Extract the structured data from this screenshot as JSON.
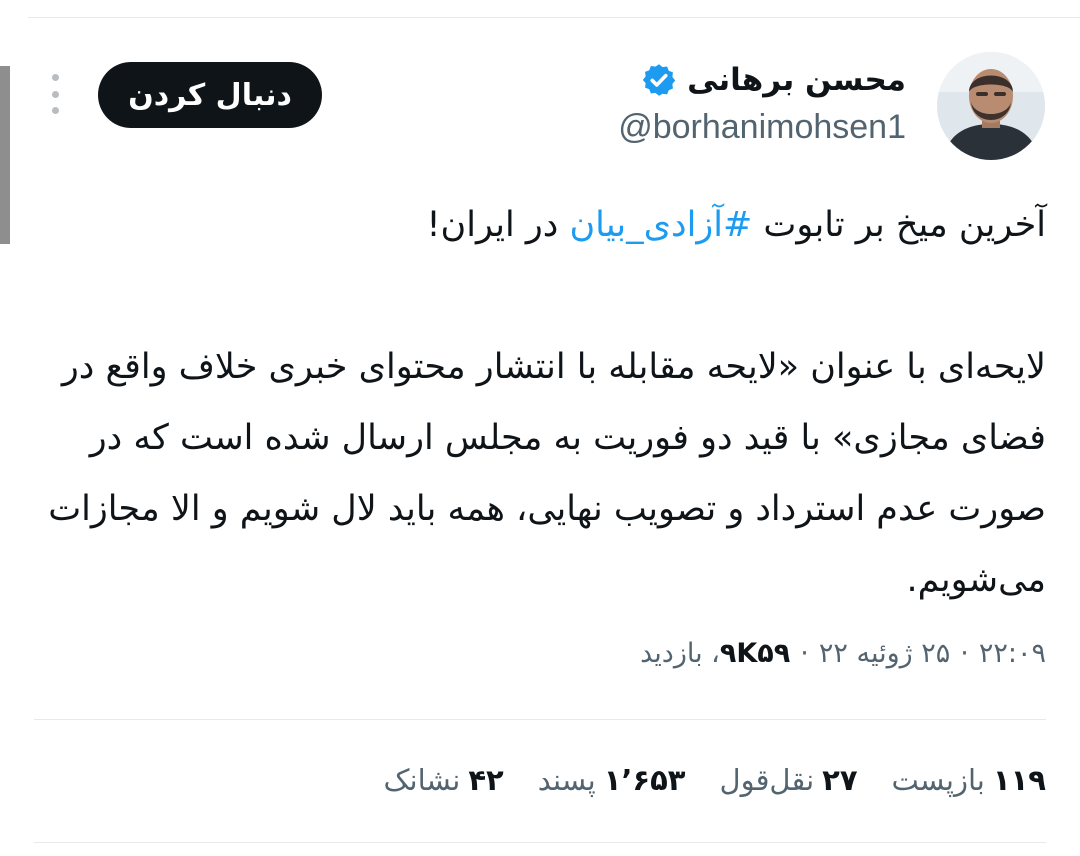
{
  "header": {
    "display_name": "محسن برهانی",
    "handle": "@borhanimohsen1",
    "follow_label": "دنبال کردن",
    "verified_color": "#1d9bf0"
  },
  "tweet": {
    "line1_before": "آخرین میخ بر تابوت ",
    "hashtag": "#آزادی_بیان",
    "line1_after": " در ایران!",
    "paragraph2": "لایحه‌ای با عنوان «لایحه مقابله با انتشار محتوای خبری خلاف واقع در فضای مجازی» با قید دو فوریت به مجلس ارسال شده است که در صورت عدم استرداد و تصویب نهایی، همه باید لال شویم و الا مجازات می‌شویم."
  },
  "meta": {
    "time": "۲۲:۰۹",
    "sep1": "·",
    "date": "۲۵ ژوئیه ۲۲",
    "sep2": "·",
    "views_count": "۹K۵۹",
    "views_label": "، بازدید"
  },
  "stats": {
    "retweets_value": "۱۱۹",
    "retweets_label": "بازپست",
    "quotes_value": "۲۷",
    "quotes_label": "نقل‌قول",
    "likes_value": "۱٬۶۵۳",
    "likes_label": "پسند",
    "bookmarks_value": "۴۲",
    "bookmarks_label": "نشانک"
  },
  "icons": {
    "verified": "verified-badge-icon",
    "more": "more-options-icon"
  },
  "colors": {
    "accent": "#1d9bf0",
    "text": "#0f1419",
    "secondary": "#536471",
    "button_bg": "#0f1419"
  }
}
